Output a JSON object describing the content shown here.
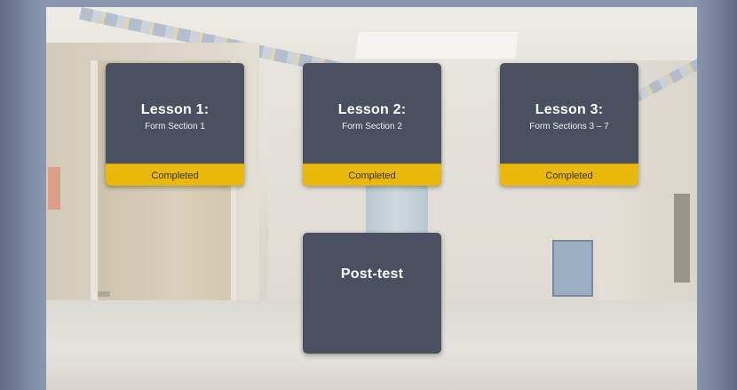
{
  "lessons": [
    {
      "title": "Lesson 1:",
      "subtitle": "Form Section 1",
      "status": "Completed"
    },
    {
      "title": "Lesson 2:",
      "subtitle": "Form Section 2",
      "status": "Completed"
    },
    {
      "title": "Lesson 3:",
      "subtitle": "Form Sections 3 – 7",
      "status": "Completed"
    }
  ],
  "post_test": {
    "title": "Post-test"
  },
  "colors": {
    "card_background": "#4a5060",
    "status_bar": "#e9b80a",
    "frame": "#8a96ae"
  }
}
